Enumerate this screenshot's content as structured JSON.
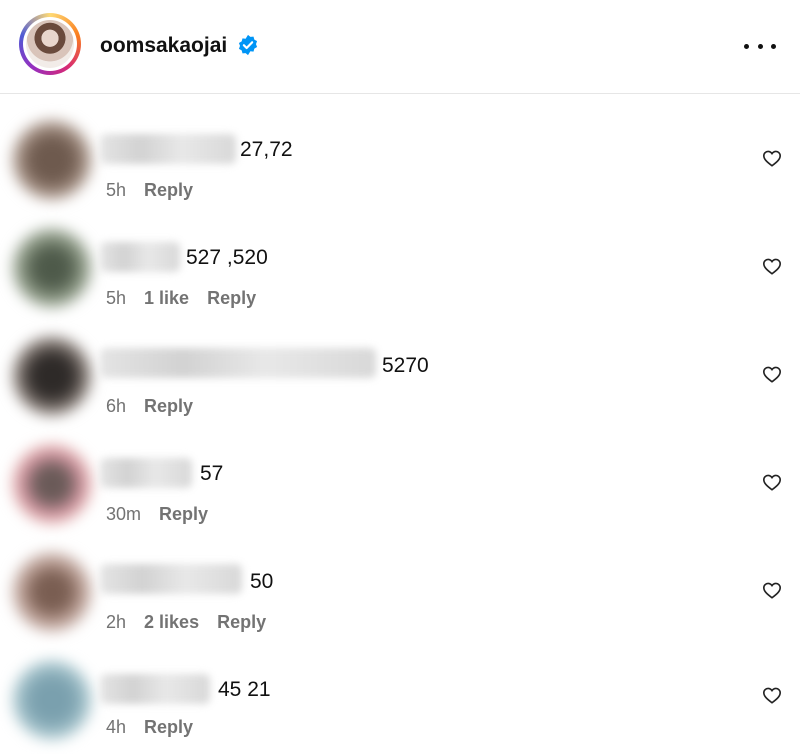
{
  "header": {
    "username": "oomsakaojai",
    "verified_color": "#0095f6",
    "more_icon": "more-horizontal-icon"
  },
  "comments": [
    {
      "text": "27,72",
      "time": "5h",
      "likes": "",
      "reply": "Reply"
    },
    {
      "text": "527 ,520",
      "time": "5h",
      "likes": "1 like",
      "reply": "Reply"
    },
    {
      "text": "5270",
      "time": "6h",
      "likes": "",
      "reply": "Reply"
    },
    {
      "text": "57",
      "time": "30m",
      "likes": "",
      "reply": "Reply"
    },
    {
      "text": "50",
      "time": "2h",
      "likes": "2 likes",
      "reply": "Reply"
    },
    {
      "text": "45 21",
      "time": "4h",
      "likes": "",
      "reply": "Reply"
    }
  ]
}
